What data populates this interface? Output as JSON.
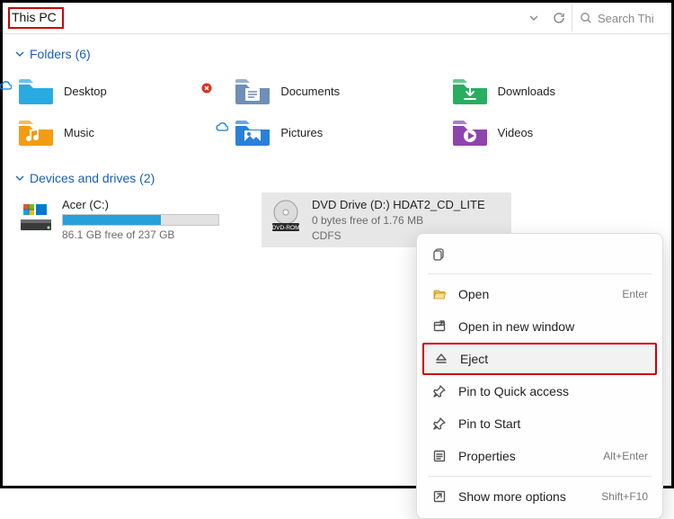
{
  "address": {
    "title": "This PC"
  },
  "search": {
    "placeholder": "Search Thi"
  },
  "sections": {
    "folders_header": "Folders (6)",
    "drives_header": "Devices and drives (2)"
  },
  "folders": [
    {
      "label": "Desktop",
      "color": "#29abe2",
      "cloud": true,
      "error": true
    },
    {
      "label": "Documents",
      "color": "#6e8fb7",
      "cloud": false,
      "error": false
    },
    {
      "label": "Downloads",
      "color": "#27ae60",
      "cloud": false,
      "error": false
    },
    {
      "label": "Music",
      "color": "#f39c12",
      "cloud": false,
      "error": false
    },
    {
      "label": "Pictures",
      "color": "#2980d9",
      "cloud": true,
      "error": false
    },
    {
      "label": "Videos",
      "color": "#8e44ad",
      "cloud": false,
      "error": false
    }
  ],
  "drives": [
    {
      "name": "Acer (C:)",
      "sub": "86.1 GB free of 237 GB",
      "fill_pct": 63,
      "type": "hdd"
    },
    {
      "name": "DVD Drive (D:) HDAT2_CD_LITE",
      "sub": "0 bytes free of 1.76 MB",
      "sub2": "CDFS",
      "type": "dvd",
      "selected": true
    }
  ],
  "context_menu": {
    "items": [
      {
        "id": "open",
        "label": "Open",
        "shortcut": "Enter",
        "icon": "folder-open-icon"
      },
      {
        "id": "open-window",
        "label": "Open in new window",
        "shortcut": "",
        "icon": "window-new-icon"
      },
      {
        "id": "eject",
        "label": "Eject",
        "shortcut": "",
        "icon": "eject-icon",
        "highlight": true,
        "hover": true
      },
      {
        "id": "pin-qa",
        "label": "Pin to Quick access",
        "shortcut": "",
        "icon": "pin-icon"
      },
      {
        "id": "pin-start",
        "label": "Pin to Start",
        "shortcut": "",
        "icon": "pin-icon"
      },
      {
        "id": "properties",
        "label": "Properties",
        "shortcut": "Alt+Enter",
        "icon": "properties-icon"
      },
      {
        "id": "more",
        "label": "Show more options",
        "shortcut": "Shift+F10",
        "icon": "more-icon"
      }
    ]
  }
}
